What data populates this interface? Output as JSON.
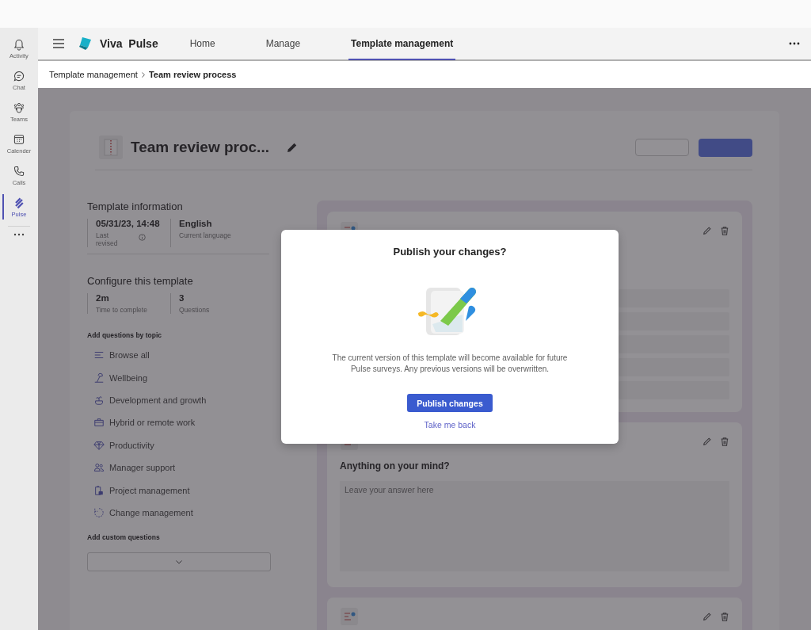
{
  "app_bar": [
    {
      "label": "Activity",
      "kind": "bell",
      "selected": false
    },
    {
      "label": "Chat",
      "kind": "chat",
      "selected": false
    },
    {
      "label": "Teams",
      "kind": "teams",
      "selected": false
    },
    {
      "label": "Calender",
      "kind": "calendar",
      "selected": false
    },
    {
      "label": "Calls",
      "kind": "phone",
      "selected": false
    },
    {
      "label": "Pulse",
      "kind": "pulse",
      "selected": true
    }
  ],
  "header": {
    "app_name": "Viva  Pulse",
    "tabs": [
      {
        "label": "Home",
        "selected": false
      },
      {
        "label": "Manage",
        "selected": false
      },
      {
        "label": "Template management",
        "selected": true
      }
    ]
  },
  "breadcrumb": [
    {
      "label": "Template management",
      "current": false
    },
    {
      "label": "Team review process",
      "current": true
    }
  ],
  "template": {
    "title": "Team review proc..."
  },
  "info": {
    "heading": "Template information",
    "stats": [
      {
        "value": "05/31/23, 14:48",
        "label": "Last revised",
        "has_info": true
      },
      {
        "value": "English",
        "label": "Current language",
        "has_info": false
      }
    ]
  },
  "configure": {
    "heading": "Configure this template",
    "stats": [
      {
        "value": "2m",
        "label": "Time to complete",
        "has_info": false
      },
      {
        "value": "3",
        "label": "Questions",
        "has_info": false
      }
    ]
  },
  "topics": {
    "heading": "Add questions by topic",
    "items": [
      {
        "label": "Browse all",
        "kind": "list"
      },
      {
        "label": "Wellbeing",
        "kind": "wellbeing"
      },
      {
        "label": "Development and growth",
        "kind": "growth"
      },
      {
        "label": "Hybrid or remote work",
        "kind": "briefcase"
      },
      {
        "label": "Productivity",
        "kind": "diamond"
      },
      {
        "label": "Manager support",
        "kind": "people"
      },
      {
        "label": "Project management",
        "kind": "clipboard"
      },
      {
        "label": "Change management",
        "kind": "cycle"
      }
    ]
  },
  "custom": {
    "heading": "Add custom questions"
  },
  "questions": [
    {
      "kind": "choice"
    },
    {
      "kind": "open",
      "title": "Anything on your mind?",
      "placeholder": "Leave your answer here"
    },
    {
      "kind": "collapsed"
    }
  ],
  "dialog": {
    "title": "Publish your changes?",
    "message": "The current version of this template will become available for future Pulse surveys. Any previous versions will be overwritten.",
    "primary": "Publish changes",
    "secondary": "Take me back"
  }
}
